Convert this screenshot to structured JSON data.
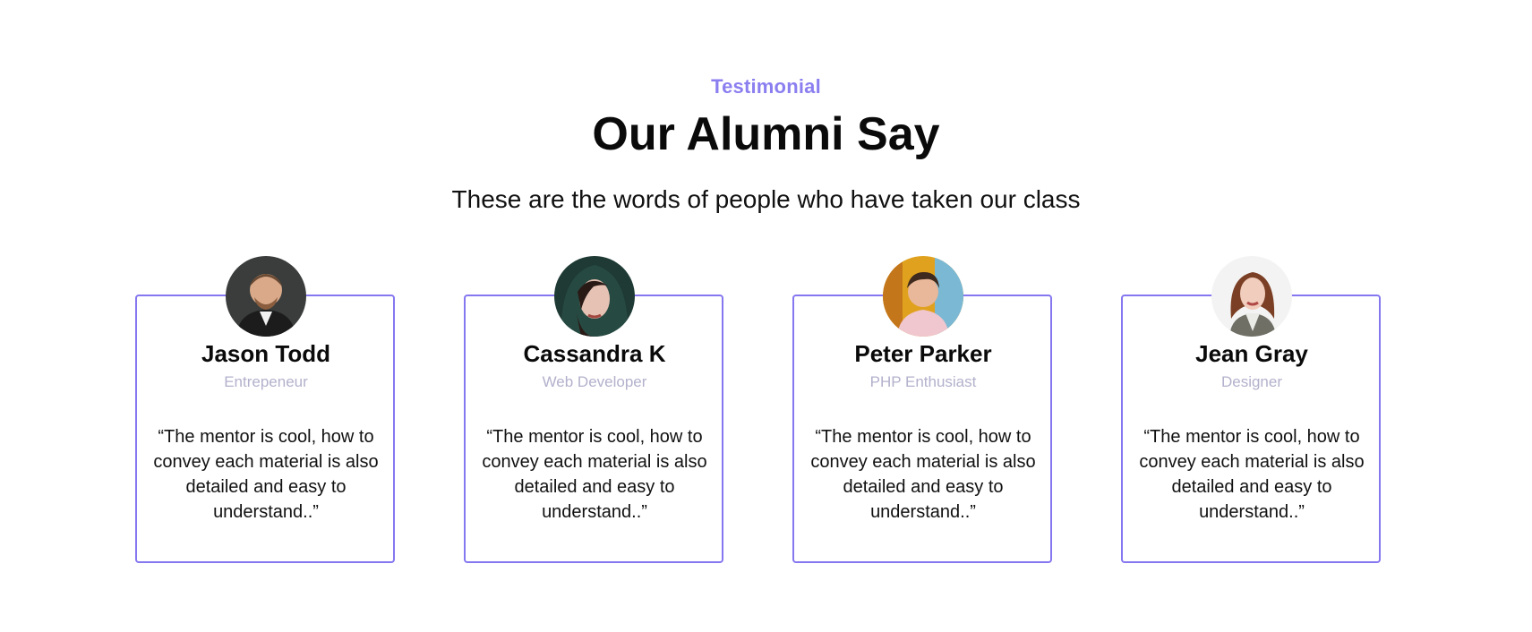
{
  "section": {
    "eyebrow": "Testimonial",
    "title": "Our Alumni Say",
    "subtitle": "These are the words of people who have taken our class"
  },
  "colors": {
    "accent": "#8b7ff0",
    "card_border": "#8577f0",
    "role_text": "#b3b1cc"
  },
  "testimonials": [
    {
      "name": "Jason Todd",
      "role": "Entrepeneur",
      "quote": "“The mentor is cool, how to convey each material is also detailed and easy to understand..”",
      "avatar_icon": "man-portrait-avatar"
    },
    {
      "name": "Cassandra K",
      "role": "Web Developer",
      "quote": "“The mentor is cool, how to convey each material is also detailed and easy to understand..”",
      "avatar_icon": "woman-hooded-portrait-avatar"
    },
    {
      "name": "Peter Parker",
      "role": "PHP Enthusiast",
      "quote": "“The mentor is cool, how to convey each material is also detailed and easy to understand..”",
      "avatar_icon": "young-man-portrait-avatar"
    },
    {
      "name": "Jean Gray",
      "role": "Designer",
      "quote": "“The mentor is cool, how to convey each material is also detailed and easy to understand..”",
      "avatar_icon": "woman-portrait-avatar"
    }
  ]
}
